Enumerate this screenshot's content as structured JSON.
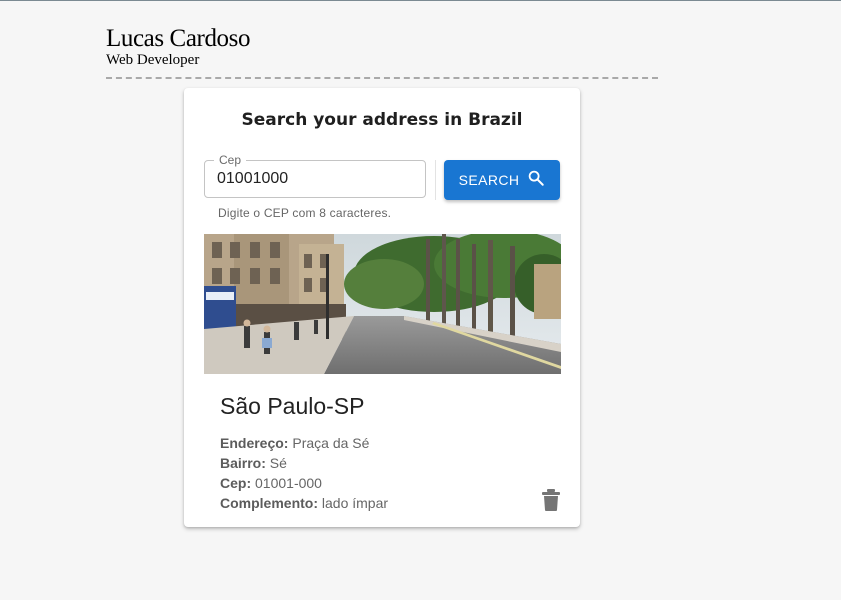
{
  "header": {
    "name": "Lucas Cardoso",
    "role": "Web Developer"
  },
  "card": {
    "title": "Search your address in Brazil",
    "cep_field": {
      "label": "Cep",
      "value": "01001000",
      "helper": "Digite o CEP com 8 caracteres."
    },
    "search_button": {
      "label": "SEARCH",
      "icon": "search-icon"
    },
    "result": {
      "image": "street-photo",
      "city": "São Paulo-SP",
      "fields": [
        {
          "label": "Endereço:",
          "value": "Praça da Sé"
        },
        {
          "label": "Bairro:",
          "value": "Sé"
        },
        {
          "label": "Cep:",
          "value": "01001-000"
        },
        {
          "label": "Complemento:",
          "value": "lado ímpar"
        }
      ],
      "delete_icon": "trash-icon"
    }
  },
  "colors": {
    "primary": "#1976d2",
    "background": "#f6f6f6",
    "icon_gray": "#757575"
  }
}
